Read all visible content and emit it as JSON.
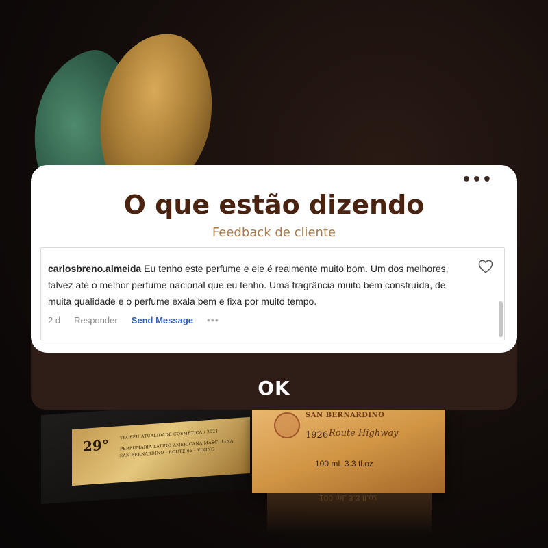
{
  "card": {
    "title": "O que estão dizendo",
    "subtitle": "Feedback de cliente",
    "more_icon": "more-horizontal-icon"
  },
  "comment": {
    "username": "carlosbreno.almeida",
    "text": "Eu tenho este perfume e ele é realmente muito bom. Um dos melhores, talvez até o melhor perfume nacional que eu tenho. Uma fragrância muito bem construída, de muita qualidade e o perfume exala bem e fixa por muito tempo.",
    "time": "2 d",
    "reply_label": "Responder",
    "send_message_label": "Send Message",
    "more_label": "•••",
    "like_icon": "heart-outline-icon"
  },
  "button": {
    "ok_label": "OK"
  },
  "background": {
    "trophy_year": "29°",
    "trophy_lines": [
      "TROFÉU ATUALIDADE COSMÉTICA / 2021",
      "PERFUMARIA LATINO AMERICANA MASCULINA",
      "SAN BERNARDINO - ROUTE 66 - VIKING"
    ],
    "box_brand": "SAN BERNARDINO",
    "box_year": "1926",
    "box_signature": "Route Highway",
    "box_volume": "100 mL  3.3 fl.oz"
  },
  "colors": {
    "title": "#4a2410",
    "subtitle": "#a77a4a",
    "panel": "#2e1d16",
    "link": "#3060b8"
  }
}
